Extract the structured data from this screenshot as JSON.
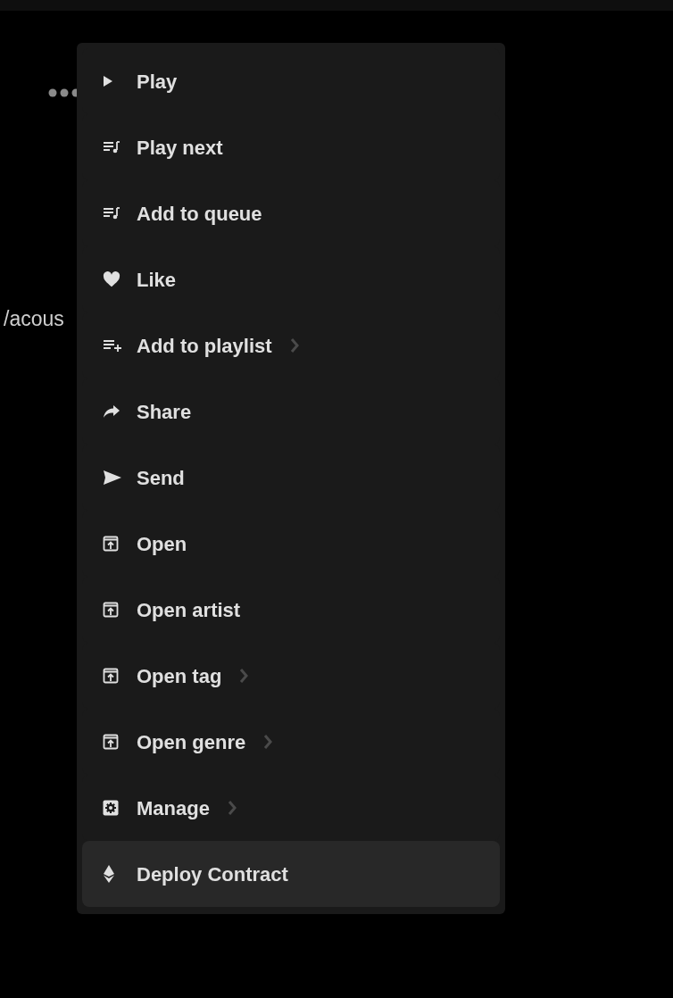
{
  "background": {
    "path_text": "/acous"
  },
  "menu": {
    "items": [
      {
        "kind": "play",
        "label": "Play",
        "submenu": false,
        "selected": false
      },
      {
        "kind": "queue",
        "label": "Play next",
        "submenu": false,
        "selected": false
      },
      {
        "kind": "queue",
        "label": "Add to queue",
        "submenu": false,
        "selected": false
      },
      {
        "kind": "heart",
        "label": "Like",
        "submenu": false,
        "selected": false
      },
      {
        "kind": "playlist-add",
        "label": "Add to playlist",
        "submenu": true,
        "selected": false
      },
      {
        "kind": "share",
        "label": "Share",
        "submenu": false,
        "selected": false
      },
      {
        "kind": "send",
        "label": "Send",
        "submenu": false,
        "selected": false
      },
      {
        "kind": "open",
        "label": "Open",
        "submenu": false,
        "selected": false
      },
      {
        "kind": "open",
        "label": "Open artist",
        "submenu": false,
        "selected": false
      },
      {
        "kind": "open",
        "label": "Open tag",
        "submenu": true,
        "selected": false
      },
      {
        "kind": "open",
        "label": "Open genre",
        "submenu": true,
        "selected": false
      },
      {
        "kind": "gear",
        "label": "Manage",
        "submenu": true,
        "selected": false
      },
      {
        "kind": "diamond",
        "label": "Deploy Contract",
        "submenu": false,
        "selected": true
      }
    ]
  }
}
